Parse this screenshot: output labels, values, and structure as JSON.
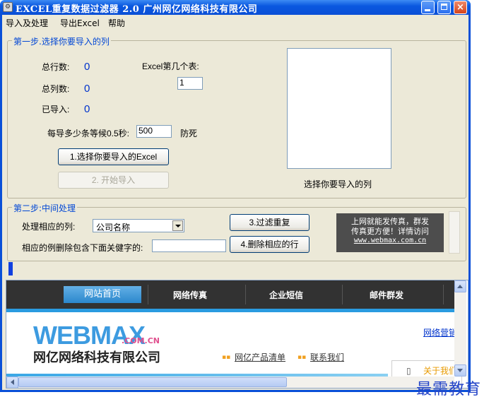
{
  "window": {
    "title": "EXCEL重复数据过滤器 2.0    广州网亿网络科技有限公司",
    "close_glyph": "×"
  },
  "menu": [
    "导入及处理",
    "导出Excel",
    "帮助"
  ],
  "step1": {
    "legend": "第一步.选择你要导入的列",
    "total_rows_label": "总行数:",
    "total_rows_value": "0",
    "total_cols_label": "总列数:",
    "total_cols_value": "0",
    "imported_label": "已导入:",
    "imported_value": "0",
    "sheet_label": "Excel第几个表:",
    "sheet_value": "1",
    "wait_label": "每导多少条等候0.5秒:",
    "wait_value": "500",
    "wait_suffix": "防死",
    "btn_select": "1.选择你要导入的Excel",
    "btn_start": "2. 开始导入",
    "list_caption": "选择你要导入的列"
  },
  "step2": {
    "legend": "第二步:中间处理",
    "col_label": "处理相应的列:",
    "col_value": "公司名称",
    "delete_label": "相应的例删除包含下面关健字的:",
    "delete_value": "",
    "btn_filter": "3.过滤重复",
    "btn_delete": "4.删除相应的行",
    "ad_line1": "上网就能发传真，群发",
    "ad_line2": "传真更方便！详情访问",
    "ad_line3": "www.webmax.com.cn"
  },
  "web": {
    "nav": [
      "网站首页",
      "网络传真",
      "企业短信",
      "邮件群发"
    ],
    "logo_a": "WEB",
    "logo_b": "MAX",
    "logo_suffix": ".COM.CN",
    "logo_cn": "网亿网络科技有限公司",
    "link_products": "网亿产品清单",
    "link_contact": "联系我们",
    "right_link": "网络营销",
    "popup": "关于我们",
    "bullet": "▪▪"
  },
  "watermark": "最需教育",
  "colors": {
    "accent": "#0046d5",
    "value_blue": "#0033cc",
    "progress": "#1040e0"
  }
}
